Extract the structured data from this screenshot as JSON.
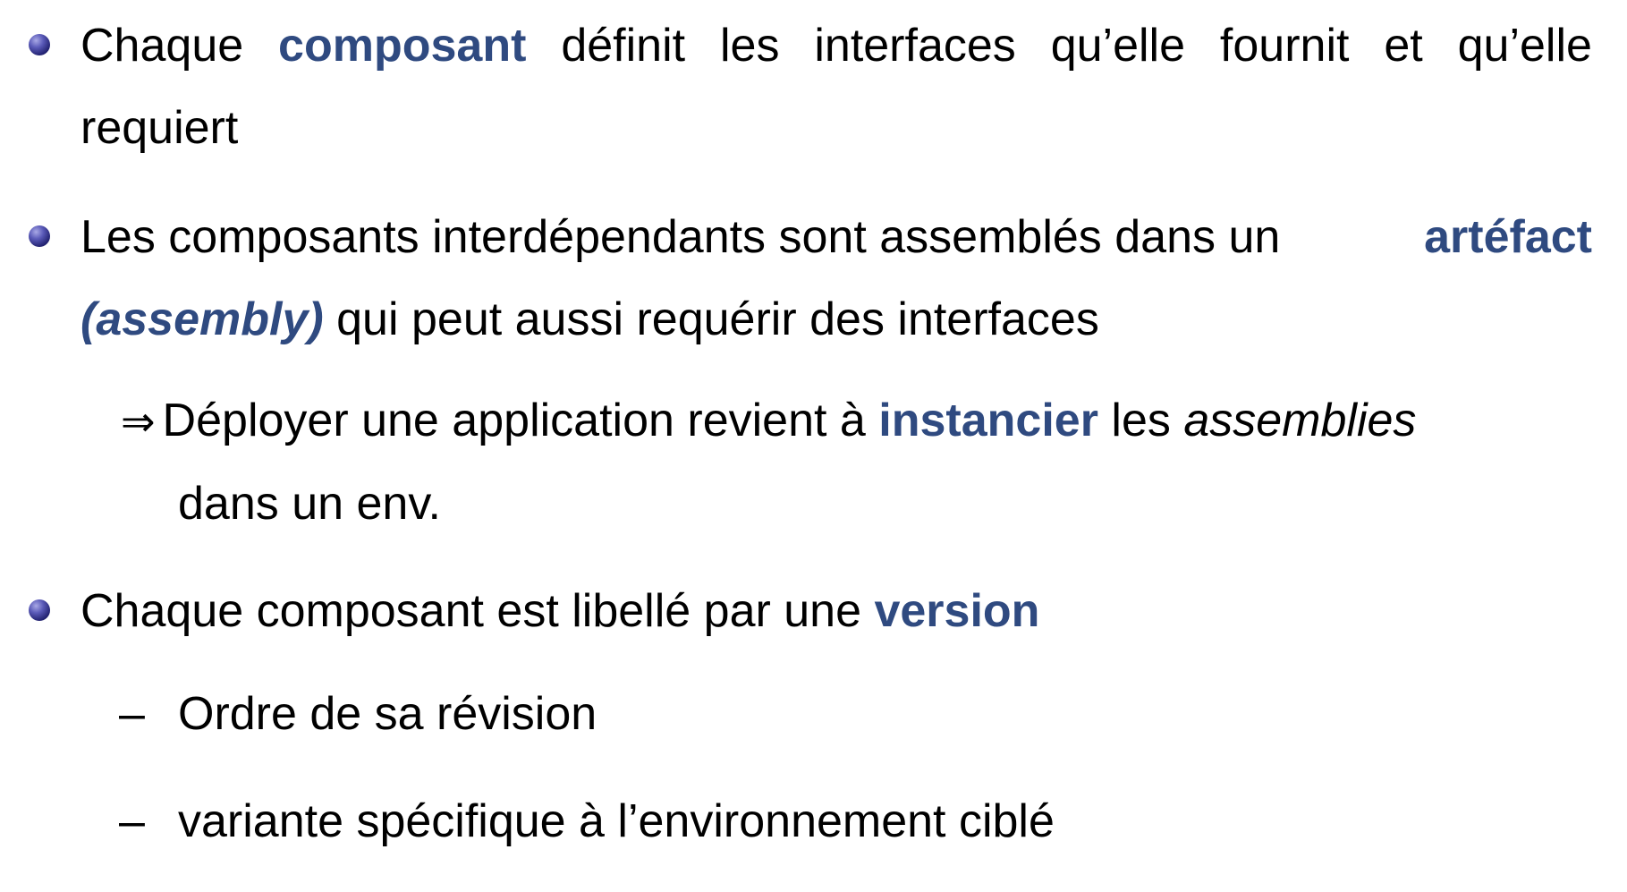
{
  "item1": {
    "w1": "Chaque",
    "w2": "composant",
    "w3": "définit",
    "w4": "les",
    "w5": "interfaces",
    "w6": "qu’elle",
    "w7": "fournit",
    "w8": "et",
    "w9": "qu’elle",
    "line2": "requiert"
  },
  "item2": {
    "line1_text": "Les composants interdépendants sont assemblés dans un",
    "line1_accent": "artéfact",
    "line2_accent": "(assembly)",
    "line2_text": "qui peut aussi requérir des interfaces"
  },
  "implication": {
    "arrow": "⇒",
    "text1": "Déployer une application revient à",
    "accent": "instancier",
    "text2": "les",
    "italic": "assemblies",
    "line2": "dans un env."
  },
  "item3": {
    "text": "Chaque composant est libellé par une",
    "accent": "version"
  },
  "subitems": [
    {
      "dash": "–",
      "text": "Ordre de sa révision"
    },
    {
      "dash": "–",
      "text": "variante spécifique à l’environnement ciblé"
    }
  ]
}
